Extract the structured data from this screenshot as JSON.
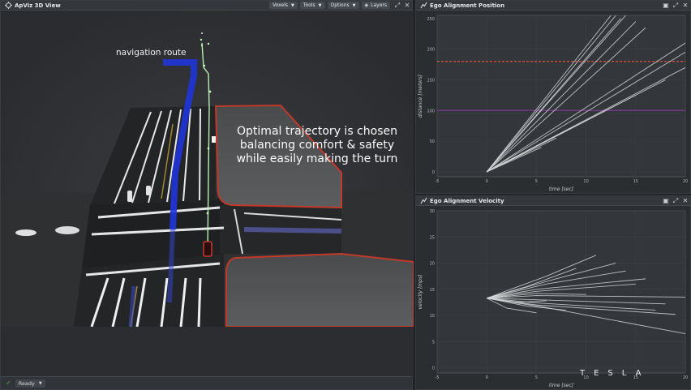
{
  "view3d": {
    "title": "ApViz 3D View",
    "toolbar": {
      "voxels": "Voxels",
      "tools": "Tools",
      "options": "Options",
      "layers": "Layers"
    },
    "nav_label": "navigation route",
    "caption": [
      "Optimal trajectory is chosen",
      "balancing comfort & safety",
      "while easily making the turn"
    ],
    "status": "Ready"
  },
  "position_panel": {
    "title": "Ego Alignment Position",
    "chart_data": {
      "type": "line",
      "xlabel": "time [sec]",
      "ylabel": "distance [meters]",
      "xlim": [
        -5,
        20
      ],
      "ylim": [
        -8,
        255
      ],
      "xticks": [
        -5,
        0,
        5,
        10,
        15,
        20
      ],
      "yticks": [
        0,
        50,
        100,
        150,
        200,
        250
      ],
      "reference_lines": [
        {
          "y": 180,
          "color": "#e0533a",
          "style": "dashed"
        },
        {
          "y": 100,
          "color": "#7a3b8f",
          "style": "solid"
        }
      ],
      "series": [
        {
          "x": [
            0,
            14
          ],
          "y": [
            0,
            255
          ]
        },
        {
          "x": [
            0,
            13
          ],
          "y": [
            0,
            255
          ]
        },
        {
          "x": [
            0,
            12.5
          ],
          "y": [
            0,
            255
          ]
        },
        {
          "x": [
            0,
            13.5
          ],
          "y": [
            0,
            250
          ]
        },
        {
          "x": [
            0,
            15
          ],
          "y": [
            0,
            245
          ]
        },
        {
          "x": [
            0,
            16
          ],
          "y": [
            0,
            235
          ]
        },
        {
          "x": [
            0,
            20
          ],
          "y": [
            0,
            210
          ]
        },
        {
          "x": [
            0,
            20
          ],
          "y": [
            0,
            195
          ]
        },
        {
          "x": [
            0,
            20
          ],
          "y": [
            0,
            170
          ]
        },
        {
          "x": [
            0,
            18
          ],
          "y": [
            0,
            150
          ]
        },
        {
          "x": [
            0,
            15
          ],
          "y": [
            0,
            125
          ]
        },
        {
          "x": [
            0,
            12
          ],
          "y": [
            0,
            100
          ]
        },
        {
          "x": [
            0,
            9
          ],
          "y": [
            0,
            75
          ]
        },
        {
          "x": [
            0,
            7
          ],
          "y": [
            0,
            55
          ]
        },
        {
          "x": [
            0,
            5.5
          ],
          "y": [
            0,
            40
          ]
        }
      ]
    }
  },
  "velocity_panel": {
    "title": "Ego Alignment Velocity",
    "chart_data": {
      "type": "line",
      "xlabel": "time [sec]",
      "ylabel": "velocity [mps]",
      "xlim": [
        -5,
        20
      ],
      "ylim": [
        -1,
        30
      ],
      "xticks": [
        -5,
        0,
        5,
        10,
        15,
        20
      ],
      "yticks": [
        0,
        5,
        10,
        15,
        20,
        25,
        30
      ],
      "series": [
        {
          "x": [
            0,
            7,
            13
          ],
          "y": [
            13.3,
            17,
            20
          ]
        },
        {
          "x": [
            0,
            6,
            11
          ],
          "y": [
            13.3,
            17.5,
            21.5
          ]
        },
        {
          "x": [
            0,
            6,
            14
          ],
          "y": [
            13.3,
            16,
            18.5
          ]
        },
        {
          "x": [
            0,
            5,
            16
          ],
          "y": [
            13.3,
            15,
            17
          ]
        },
        {
          "x": [
            0,
            5,
            15
          ],
          "y": [
            13.3,
            14.6,
            16
          ]
        },
        {
          "x": [
            0,
            5,
            20
          ],
          "y": [
            13.3,
            13.8,
            13.5
          ]
        },
        {
          "x": [
            0,
            5,
            18
          ],
          "y": [
            13.3,
            13,
            12.2
          ]
        },
        {
          "x": [
            0,
            5,
            17
          ],
          "y": [
            13.3,
            12.4,
            11
          ]
        },
        {
          "x": [
            0,
            5,
            19
          ],
          "y": [
            13.3,
            12,
            10.2
          ]
        },
        {
          "x": [
            0,
            6,
            20
          ],
          "y": [
            13.3,
            11.5,
            6.5
          ]
        },
        {
          "x": [
            0,
            4,
            8
          ],
          "y": [
            13.3,
            11.8,
            11
          ]
        },
        {
          "x": [
            0,
            3,
            6
          ],
          "y": [
            13.3,
            12.5,
            12.8
          ]
        },
        {
          "x": [
            0,
            2,
            5
          ],
          "y": [
            13.3,
            11.4,
            10.5
          ]
        },
        {
          "x": [
            0,
            5,
            10
          ],
          "y": [
            13.3,
            14.2,
            14
          ]
        },
        {
          "x": [
            0,
            4,
            9
          ],
          "y": [
            13.3,
            15.5,
            19
          ]
        }
      ]
    }
  },
  "watermark": "TESLA"
}
